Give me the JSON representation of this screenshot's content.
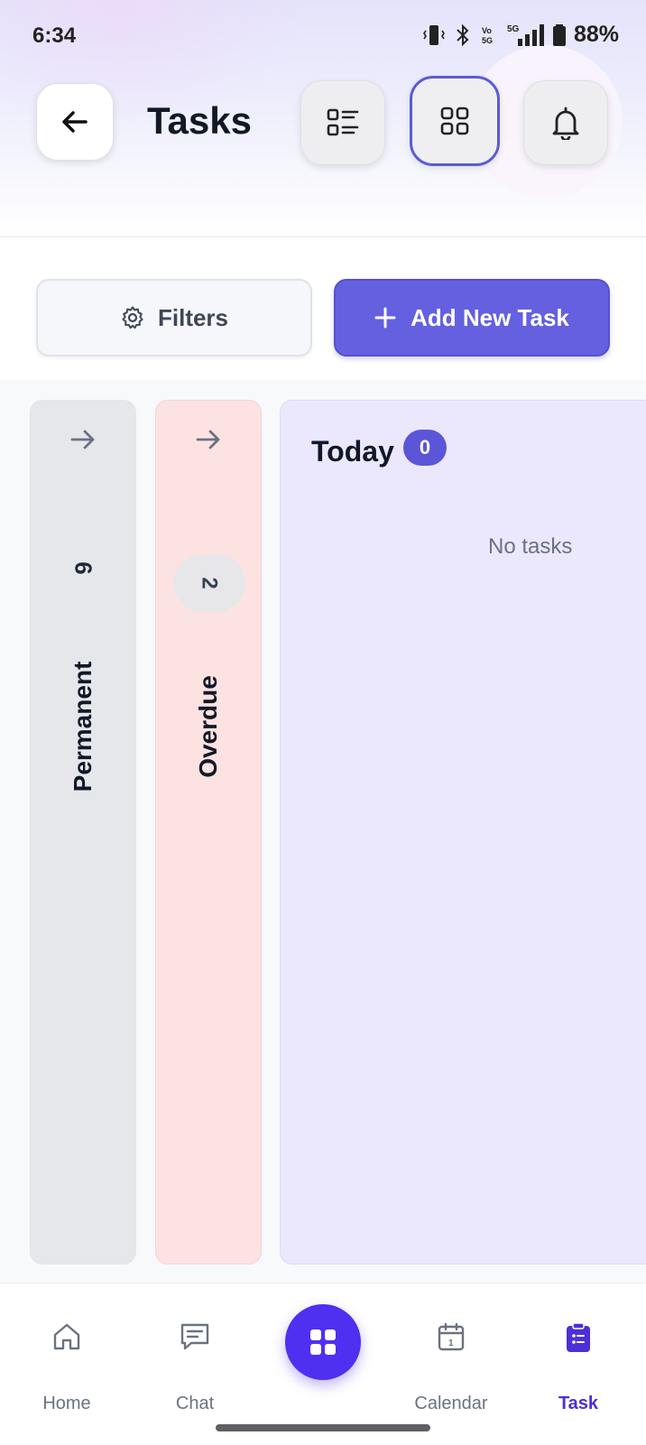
{
  "status_bar": {
    "time": "6:34",
    "battery": "88%"
  },
  "header": {
    "title": "Tasks"
  },
  "toolbar": {
    "filters_label": "Filters",
    "add_label": "Add New Task"
  },
  "columns": {
    "permanent": {
      "title": "Permanent",
      "count": "6"
    },
    "overdue": {
      "title": "Overdue",
      "count": "2"
    },
    "today": {
      "title": "Today",
      "count": "0",
      "empty_text": "No tasks"
    }
  },
  "nav": {
    "items": [
      {
        "label": "Home",
        "icon": "home-icon"
      },
      {
        "label": "Chat",
        "icon": "chat-icon"
      },
      {
        "label": "Calendar",
        "icon": "calendar-icon"
      },
      {
        "label": "Task",
        "icon": "task-icon",
        "active": true
      }
    ],
    "center": {
      "icon": "grid-icon"
    }
  },
  "colors": {
    "accent": "#6560e0",
    "active_nav": "#4c2fd6",
    "permanent_bg": "#e5e7eb",
    "overdue_bg": "#fde2e2",
    "today_bg": "#ebe8fe"
  }
}
